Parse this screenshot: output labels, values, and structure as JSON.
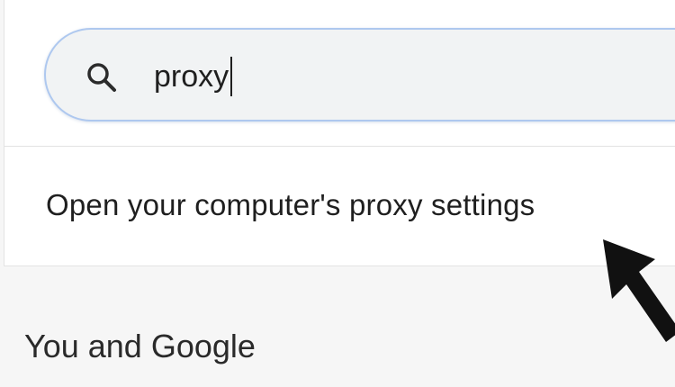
{
  "search": {
    "value": "proxy",
    "icon": "search-icon"
  },
  "results": {
    "proxy_link": "Open your computer's proxy settings"
  },
  "sections": {
    "you_and_google": "You and Google"
  },
  "annotation": {
    "icon": "pointer-arrow-icon"
  },
  "colors": {
    "search_border": "#aec8ef",
    "search_bg": "#f1f3f4",
    "page_bg": "#f6f6f6",
    "card_bg": "#ffffff",
    "text": "#1f1f1f"
  }
}
